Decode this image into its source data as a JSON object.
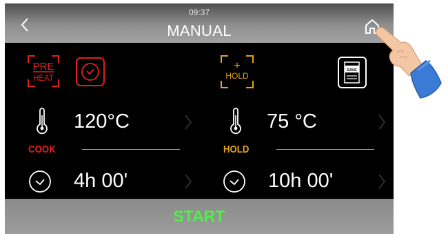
{
  "header": {
    "time": "09:37",
    "title": "MANUAL",
    "back_icon": "chevron-left-icon",
    "home_icon": "home-icon"
  },
  "tools": {
    "preheat_line1": "PRE",
    "preheat_line2": "HEAT",
    "timer_icon": "clock-icon",
    "hold_plus": "+",
    "hold_label": "HOLD",
    "save_label": "SAVE"
  },
  "cook": {
    "label": "COOK",
    "temperature": "120°C",
    "time": "4h 00'"
  },
  "hold": {
    "label": "HOLD",
    "temperature": "75 °C",
    "time": "10h 00'"
  },
  "footer": {
    "start_label": "START"
  },
  "colors": {
    "cook_accent": "#e0211a",
    "hold_accent": "#e8a11c",
    "start_text": "#50ee46",
    "background": "#000000"
  },
  "overlay": {
    "pointer": "pointing-hand-icon"
  }
}
